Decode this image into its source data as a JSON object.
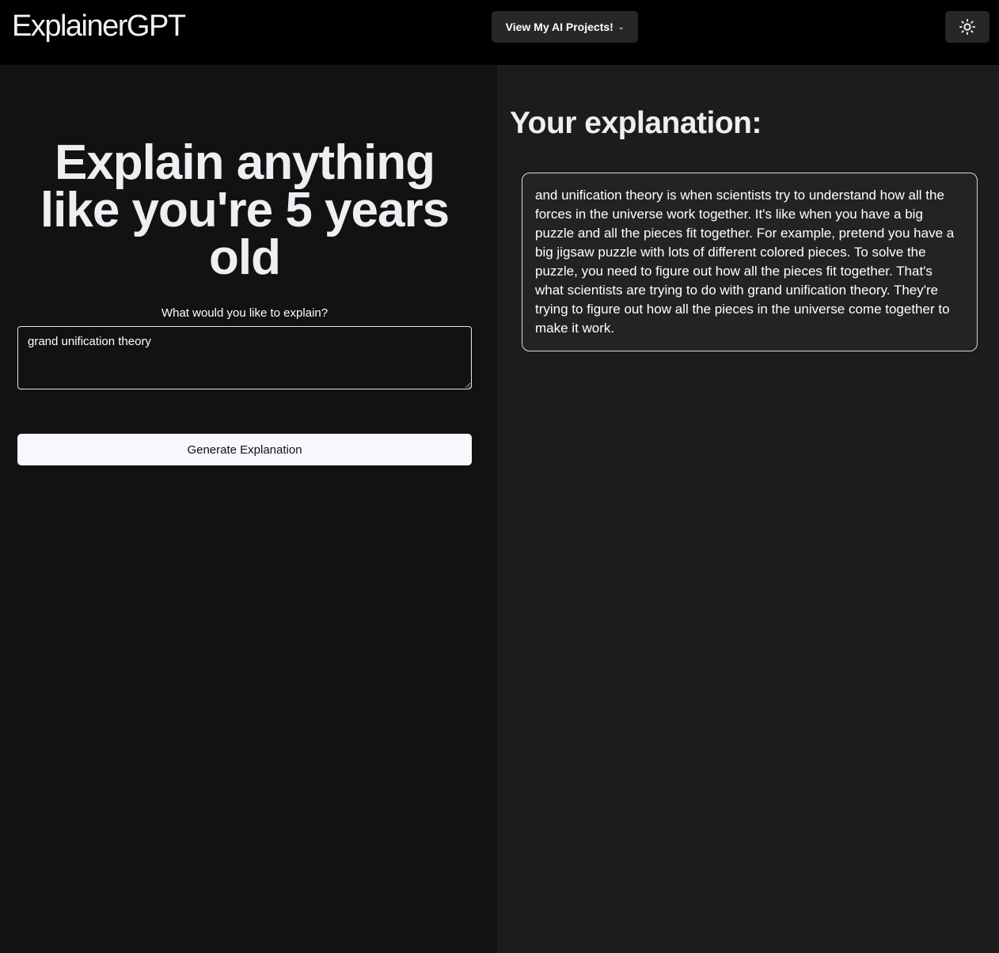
{
  "header": {
    "logo": "ExplainerGPT",
    "projects_label": "View My AI Projects!",
    "theme_icon": "sun-icon"
  },
  "left": {
    "title": "Explain anything like you're 5 years old",
    "prompt_label": "What would you like to explain?",
    "input_value": "grand unification theory",
    "generate_label": "Generate Explanation"
  },
  "right": {
    "heading": "Your explanation:",
    "explanation": "and unification theory is when scientists try to understand how all the forces in the universe work together. It's like when you have a big puzzle and all the pieces fit together. For example, pretend you have a big jigsaw puzzle with lots of different colored pieces. To solve the puzzle, you need to figure out how all the pieces fit together. That's what scientists are trying to do with grand unification theory. They're trying to figure out how all the pieces in the universe come together to make it work."
  }
}
